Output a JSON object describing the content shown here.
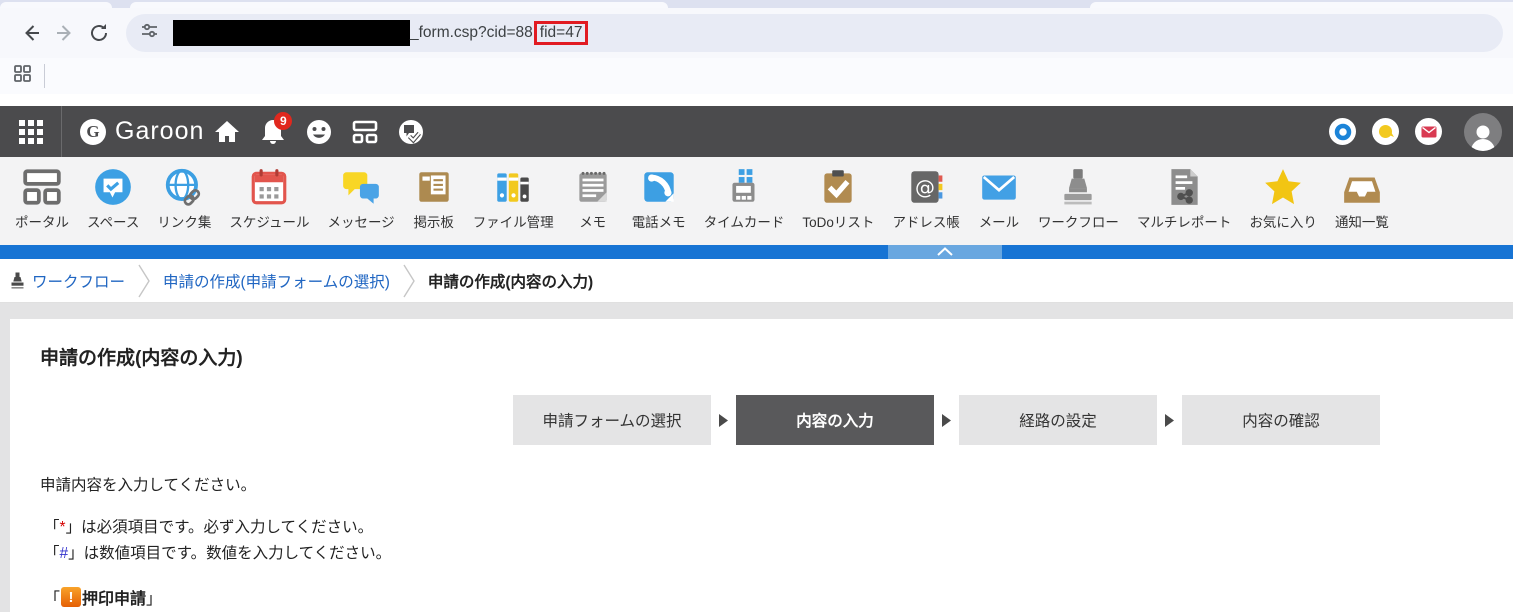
{
  "browser": {
    "url_visible": "_form.csp?cid=88",
    "url_highlighted": "fid=47",
    "highlight_color": "#e11b22"
  },
  "header": {
    "logo_letter": "G",
    "logo_text": "Garoon",
    "notification_count": "9",
    "bg_color": "#4b4b4d"
  },
  "appbar": {
    "items": [
      {
        "id": "portal",
        "label": "ポータル",
        "icon": "portal-icon"
      },
      {
        "id": "space",
        "label": "スペース",
        "icon": "space-icon"
      },
      {
        "id": "links",
        "label": "リンク集",
        "icon": "links-icon"
      },
      {
        "id": "schedule",
        "label": "スケジュール",
        "icon": "schedule-icon"
      },
      {
        "id": "message",
        "label": "メッセージ",
        "icon": "message-icon"
      },
      {
        "id": "bulletin",
        "label": "掲示板",
        "icon": "bulletin-icon"
      },
      {
        "id": "cabinet",
        "label": "ファイル管理",
        "icon": "cabinet-icon"
      },
      {
        "id": "memo",
        "label": "メモ",
        "icon": "memo-icon"
      },
      {
        "id": "phonemessage",
        "label": "電話メモ",
        "icon": "phone-memo-icon"
      },
      {
        "id": "timecard",
        "label": "タイムカード",
        "icon": "timecard-icon"
      },
      {
        "id": "todo",
        "label": "ToDoリスト",
        "icon": "todo-icon"
      },
      {
        "id": "address",
        "label": "アドレス帳",
        "icon": "address-icon"
      },
      {
        "id": "mail",
        "label": "メール",
        "icon": "mail-icon"
      },
      {
        "id": "workflow",
        "label": "ワークフロー",
        "icon": "workflow-icon"
      },
      {
        "id": "multireport",
        "label": "マルチレポート",
        "icon": "multireport-icon"
      },
      {
        "id": "favorite",
        "label": "お気に入り",
        "icon": "favorite-icon"
      },
      {
        "id": "notification",
        "label": "通知一覧",
        "icon": "notification-icon"
      }
    ]
  },
  "accent": {
    "blue_bar": "#1774d4",
    "link_blue": "#2066c2"
  },
  "breadcrumb": {
    "items": [
      {
        "label": "ワークフロー",
        "link": true
      },
      {
        "label": "申請の作成(申請フォームの選択)",
        "link": true
      },
      {
        "label": "申請の作成(内容の入力)",
        "link": false
      }
    ]
  },
  "main": {
    "title": "申請の作成(内容の入力)",
    "steps": [
      {
        "label": "申請フォームの選択",
        "active": false
      },
      {
        "label": "内容の入力",
        "active": true
      },
      {
        "label": "経路の設定",
        "active": false
      },
      {
        "label": "内容の確認",
        "active": false
      }
    ],
    "instruction": "申請内容を入力してください。",
    "notes": [
      {
        "before": "「",
        "symbol": "*",
        "symbol_color": "#d40000",
        "after": "」は必須項目です。必ず入力してください。"
      },
      {
        "before": "「",
        "symbol": "#",
        "symbol_color": "#3333cc",
        "after": "」は数値項目です。数値を入力してください。"
      }
    ],
    "form_line": {
      "before": "「",
      "alert_mark": "!",
      "name": "押印申請",
      "after": "」"
    }
  }
}
